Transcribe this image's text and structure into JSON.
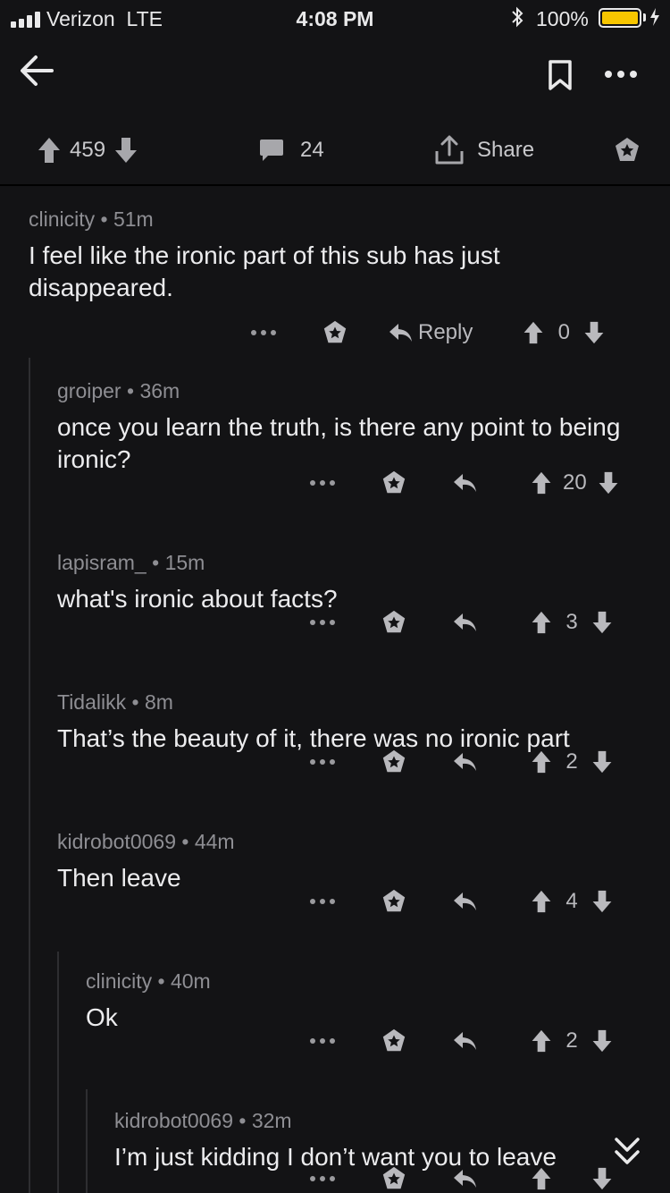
{
  "status_bar": {
    "carrier": "Verizon",
    "network": "LTE",
    "time": "4:08 PM",
    "battery_percent": "100%",
    "battery_color": "#f7c600"
  },
  "nav": {
    "back_icon": "arrow-left",
    "bookmark_icon": "bookmark",
    "more_icon": "ellipsis"
  },
  "post_actions": {
    "score": "459",
    "comment_count": "24",
    "share_label": "Share"
  },
  "comments": [
    {
      "author": "clinicity",
      "age": "51m",
      "text": "I feel like the ironic part of this sub has just disappeared.",
      "reply_label": "Reply",
      "score": "0"
    },
    {
      "author": "groiper",
      "age": "36m",
      "text": "once you learn the truth, is there any point to being ironic?",
      "score": "20"
    },
    {
      "author": "lapisram_",
      "age": "15m",
      "text": "what's ironic about facts?",
      "score": "3"
    },
    {
      "author": "Tidalikk",
      "age": "8m",
      "text": "That’s the beauty of it, there was no ironic part",
      "score": "2"
    },
    {
      "author": "kidrobot0069",
      "age": "44m",
      "text": "Then leave",
      "score": "4"
    },
    {
      "author": "clinicity",
      "age": "40m",
      "text": "Ok",
      "score": "2"
    },
    {
      "author": "kidrobot0069",
      "age": "32m",
      "text": "I’m just kidding I don’t want you to leave",
      "score": ""
    }
  ],
  "separator": "•"
}
